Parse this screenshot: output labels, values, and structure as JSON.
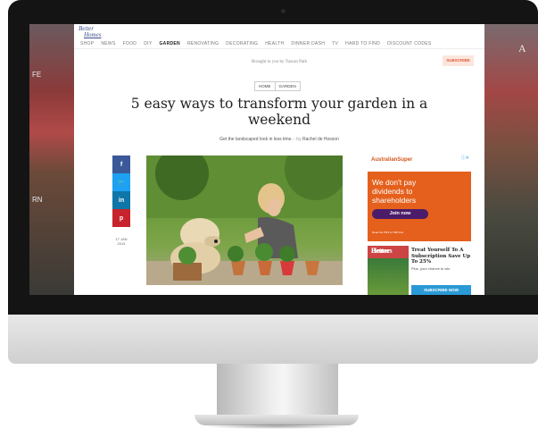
{
  "site": {
    "logo_line1": "Better",
    "logo_line2": "Homes",
    "nav": [
      "SHOP",
      "NEWS",
      "FOOD",
      "DIY",
      "GARDEN",
      "RENOVATING",
      "DECORATING",
      "HEALTH",
      "DINNER DASH",
      "TV",
      "HARD TO FIND",
      "DISCOUNT CODES"
    ],
    "nav_active": "GARDEN",
    "sponsor": "Brought to you by Tuscan Path",
    "subscribe_label": "SUBSCRIBE"
  },
  "article": {
    "breadcrumbs": [
      "HOME",
      "GARDEN"
    ],
    "title": "5 easy ways to transform your garden in a weekend",
    "deck": "Get the landscaped look in less time.",
    "by_prefix": "- by",
    "author": "Rachel de Hosson",
    "date_line1": "17 JAN",
    "date_line2": "2014"
  },
  "share": [
    {
      "icon": "facebook-icon",
      "glyph": "f",
      "color": "#3b5998"
    },
    {
      "icon": "twitter-icon",
      "glyph": "🐦",
      "color": "#1da1f2"
    },
    {
      "icon": "linkedin-icon",
      "glyph": "in",
      "color": "#0e76a8"
    },
    {
      "icon": "pinterest-icon",
      "glyph": "p",
      "color": "#c8232c"
    }
  ],
  "ad_super": {
    "brand": "AustralianSuper",
    "message": "We don't pay dividends to shareholders",
    "button": "Join now",
    "fine_print": "Read the PDS & TMD first."
  },
  "ad_mag": {
    "mag_line1": "Better",
    "mag_line2": "Homes",
    "title": "Treat Yourself To A Subscription Save Up To 25%",
    "subtitle": "Plus, your chance to win",
    "button": "SUBSCRIBE NOW"
  },
  "background_text": {
    "left_1": "FE",
    "left_2": "RN",
    "right": "A"
  },
  "colors": {
    "bezel": "#141414",
    "subscribe_accent": "#e05a3a",
    "ad_orange": "#e4601c",
    "ad_button": "#4a1c6a",
    "link_blue": "#2a9ad6"
  }
}
